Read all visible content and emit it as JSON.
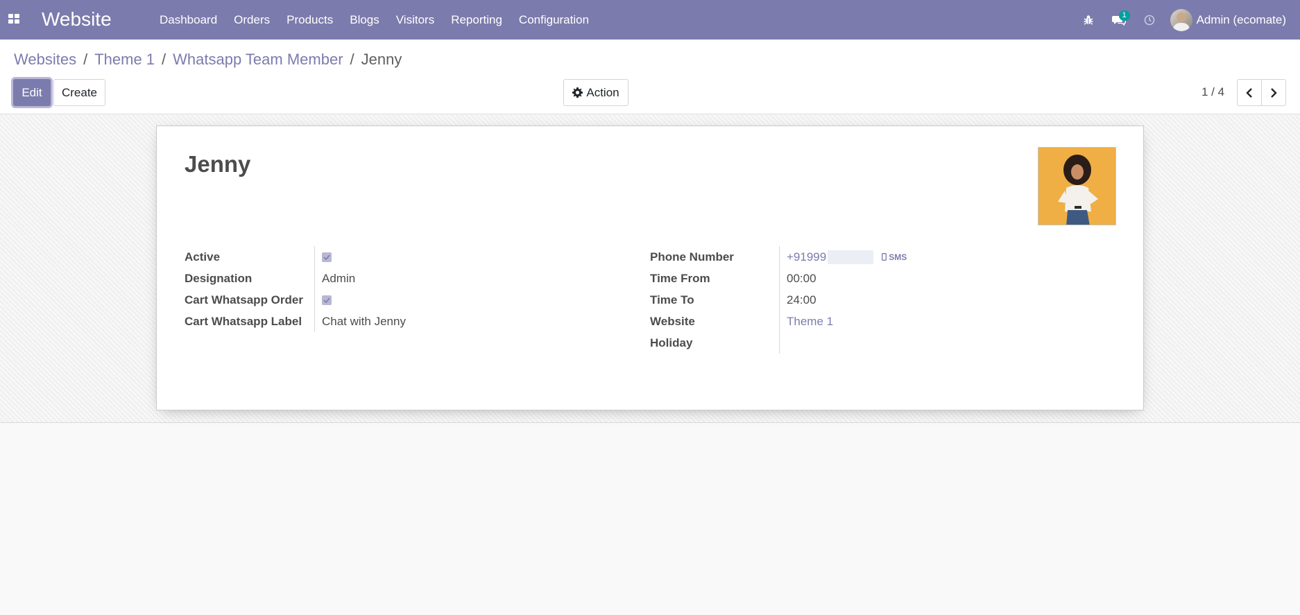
{
  "navbar": {
    "app_title": "Website",
    "menu": [
      "Dashboard",
      "Orders",
      "Products",
      "Blogs",
      "Visitors",
      "Reporting",
      "Configuration"
    ],
    "messages_badge": "1",
    "user_name": "Admin (ecomate)",
    "icons": [
      "apps-icon",
      "bug-icon",
      "chat-icon",
      "clock-icon"
    ]
  },
  "breadcrumb": {
    "items": [
      "Websites",
      "Theme 1",
      "Whatsapp Team Member"
    ],
    "current": "Jenny",
    "separator": "/"
  },
  "buttons": {
    "edit": "Edit",
    "create": "Create",
    "action": "Action"
  },
  "pager": {
    "value": "1 / 4"
  },
  "record": {
    "name": "Jenny",
    "left_fields": [
      {
        "label": "Active",
        "checked": true
      },
      {
        "label": "Designation",
        "value": "Admin"
      },
      {
        "label": "Cart Whatsapp Order",
        "checked": true
      },
      {
        "label": "Cart Whatsapp Label",
        "value": "Chat with Jenny"
      }
    ],
    "right_fields": [
      {
        "label": "Phone Number",
        "value": "+91999",
        "sms_label": "SMS"
      },
      {
        "label": "Time From",
        "value": "00:00"
      },
      {
        "label": "Time To",
        "value": "24:00"
      },
      {
        "label": "Website",
        "value": "Theme 1"
      },
      {
        "label": "Holiday",
        "value": ""
      }
    ]
  },
  "colors": {
    "brand": "#7c7bad",
    "badge": "#00a09d",
    "photo_background": "#efaf45"
  }
}
